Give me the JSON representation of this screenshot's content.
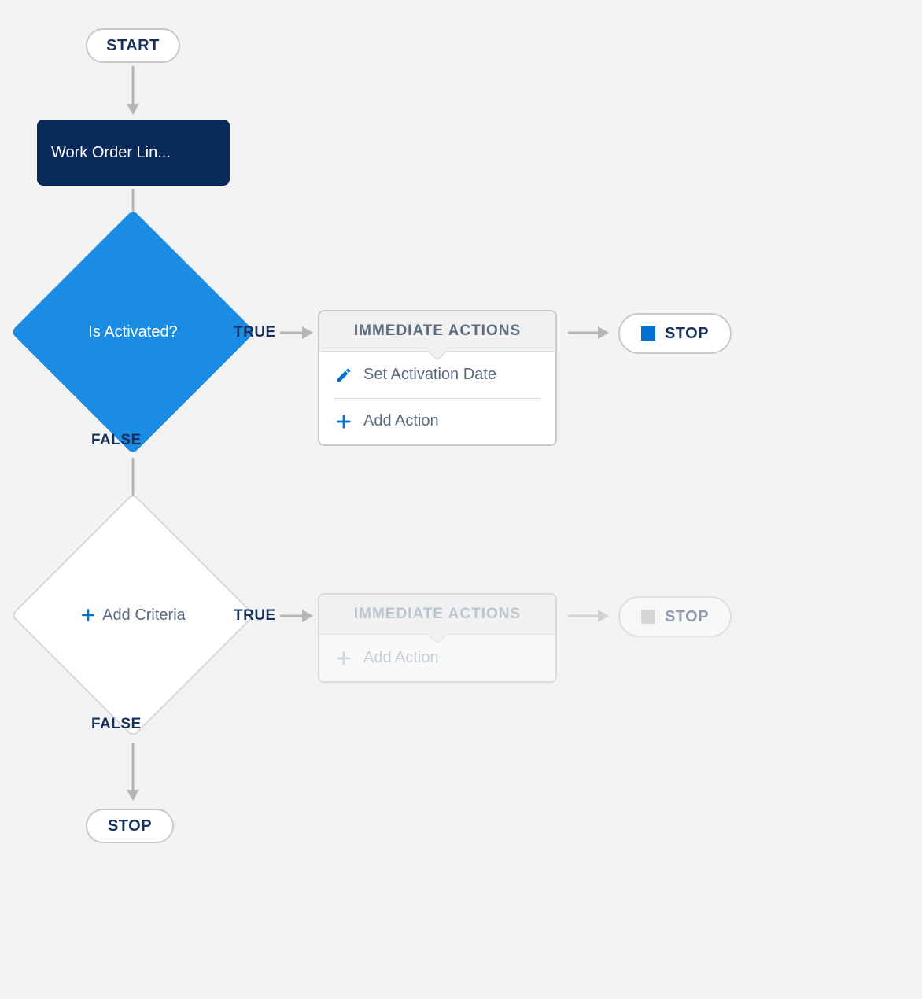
{
  "start": {
    "label": "START"
  },
  "end": {
    "label": "STOP"
  },
  "object": {
    "label": "Work Order Lin..."
  },
  "criteria": [
    {
      "label": "Is Activated?",
      "true_label": "TRUE",
      "false_label": "FALSE",
      "actions_header": "IMMEDIATE ACTIONS",
      "actions": [
        {
          "label": "Set Activation Date"
        }
      ],
      "add_action_label": "Add Action",
      "stop_label": "STOP"
    },
    {
      "label": "Add Criteria",
      "true_label": "TRUE",
      "false_label": "FALSE",
      "actions_header": "IMMEDIATE ACTIONS",
      "actions": [],
      "add_action_label": "Add Action",
      "stop_label": "STOP"
    }
  ]
}
